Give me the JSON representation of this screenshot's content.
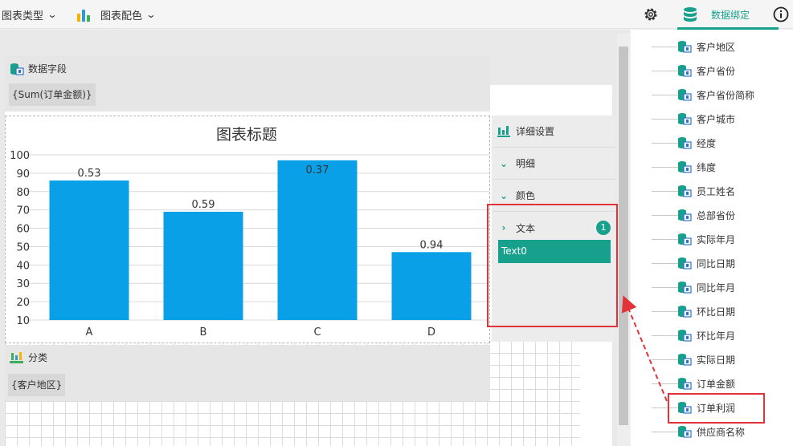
{
  "toolbar": {
    "chart_type_label": "图表类型",
    "chart_color_label": "图表配色",
    "data_binding_label": "数据绑定",
    "accent_color": "#17a08c"
  },
  "data_fields_panel": {
    "title": "数据字段",
    "value_chip": "{Sum(订单金额)}"
  },
  "category_panel": {
    "title": "分类",
    "value_chip": "{客户地区}"
  },
  "detail_panel": {
    "title": "详细设置",
    "rows": [
      "明细",
      "颜色",
      "文本"
    ],
    "text_count": "1",
    "selected_item": "Text0"
  },
  "fields": [
    "客户地区",
    "客户省份",
    "客户省份简称",
    "客户城市",
    "经度",
    "纬度",
    "员工姓名",
    "总部省份",
    "实际年月",
    "同比日期",
    "同比年月",
    "环比日期",
    "环比年月",
    "实际日期",
    "订单金额",
    "订单利润",
    "供应商名称"
  ],
  "highlighted_field": "订单利润",
  "chart_data": {
    "type": "bar",
    "title": "图表标题",
    "categories": [
      "A",
      "B",
      "C",
      "D"
    ],
    "values": [
      86,
      69,
      97,
      47
    ],
    "data_labels": [
      "0.53",
      "0.59",
      "0.37",
      "0.94"
    ],
    "y_ticks": [
      10,
      20,
      30,
      40,
      50,
      60,
      70,
      80,
      90,
      100
    ],
    "ylim": [
      10,
      100
    ],
    "bar_color": "#0aa0e8",
    "grid": true
  }
}
